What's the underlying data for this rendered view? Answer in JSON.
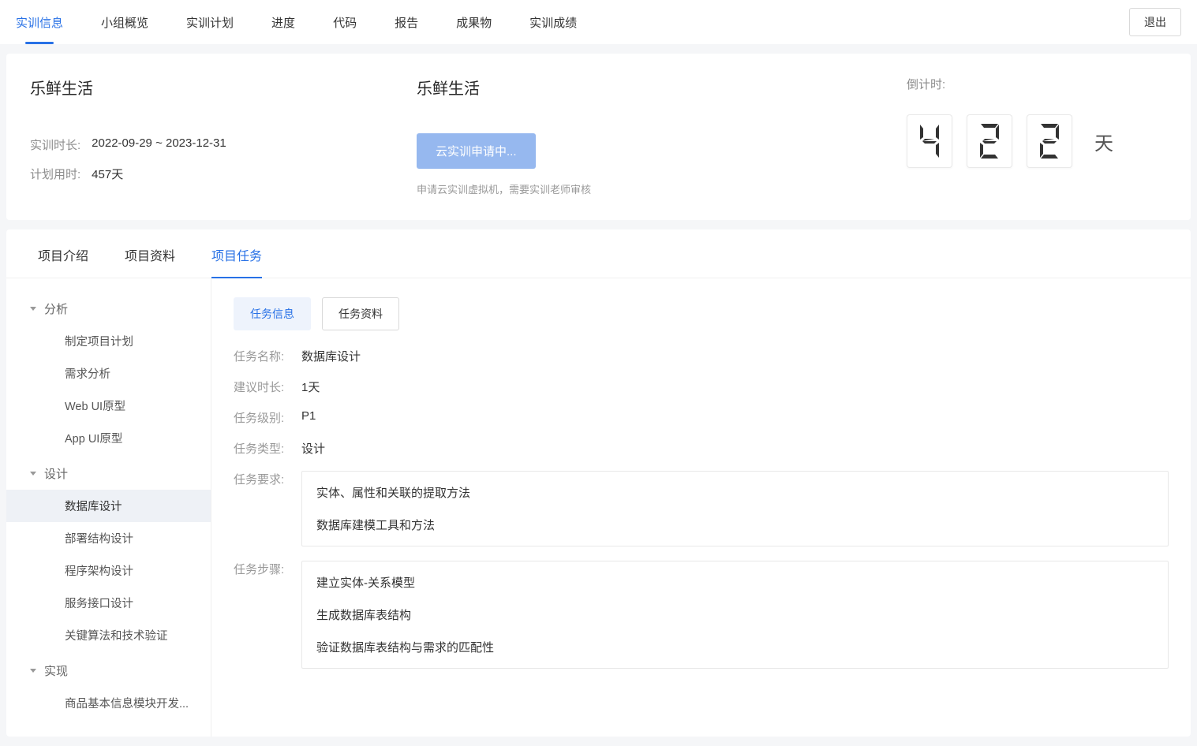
{
  "topNav": {
    "tabs": [
      "实训信息",
      "小组概览",
      "实训计划",
      "进度",
      "代码",
      "报告",
      "成果物",
      "实训成绩"
    ],
    "activeIndex": 0,
    "exit": "退出"
  },
  "infoCard": {
    "leftTitle": "乐鲜生活",
    "durationLabel": "实训时长:",
    "durationValue": "2022-09-29 ~ 2023-12-31",
    "planLabel": "计划用时:",
    "planValue": "457天",
    "middleTitle": "乐鲜生活",
    "applyBtn": "云实训申请中...",
    "applyNote": "申请云实训虚拟机，需要实训老师审核",
    "countdownLabel": "倒计时:",
    "countdownDigits": [
      "4",
      "2",
      "2"
    ],
    "countdownUnit": "天"
  },
  "subTabs": {
    "items": [
      "项目介绍",
      "项目资料",
      "项目任务"
    ],
    "activeIndex": 2
  },
  "tree": [
    {
      "label": "分析",
      "children": [
        "制定项目计划",
        "需求分析",
        "Web UI原型",
        "App UI原型"
      ]
    },
    {
      "label": "设计",
      "children": [
        "数据库设计",
        "部署结构设计",
        "程序架构设计",
        "服务接口设计",
        "关键算法和技术验证"
      ]
    },
    {
      "label": "实现",
      "children": [
        "商品基本信息模块开发..."
      ]
    }
  ],
  "treeActive": {
    "group": 1,
    "child": 0
  },
  "segBtns": {
    "items": [
      "任务信息",
      "任务资料"
    ],
    "activeIndex": 0
  },
  "task": {
    "nameLabel": "任务名称:",
    "nameValue": "数据库设计",
    "durationLabel": "建议时长:",
    "durationValue": "1天",
    "levelLabel": "任务级别:",
    "levelValue": "P1",
    "typeLabel": "任务类型:",
    "typeValue": "设计",
    "reqLabel": "任务要求:",
    "reqLines": [
      "实体、属性和关联的提取方法",
      "数据库建模工具和方法"
    ],
    "stepLabel": "任务步骤:",
    "stepLines": [
      "建立实体-关系模型",
      "生成数据库表结构",
      "验证数据库表结构与需求的匹配性"
    ]
  }
}
